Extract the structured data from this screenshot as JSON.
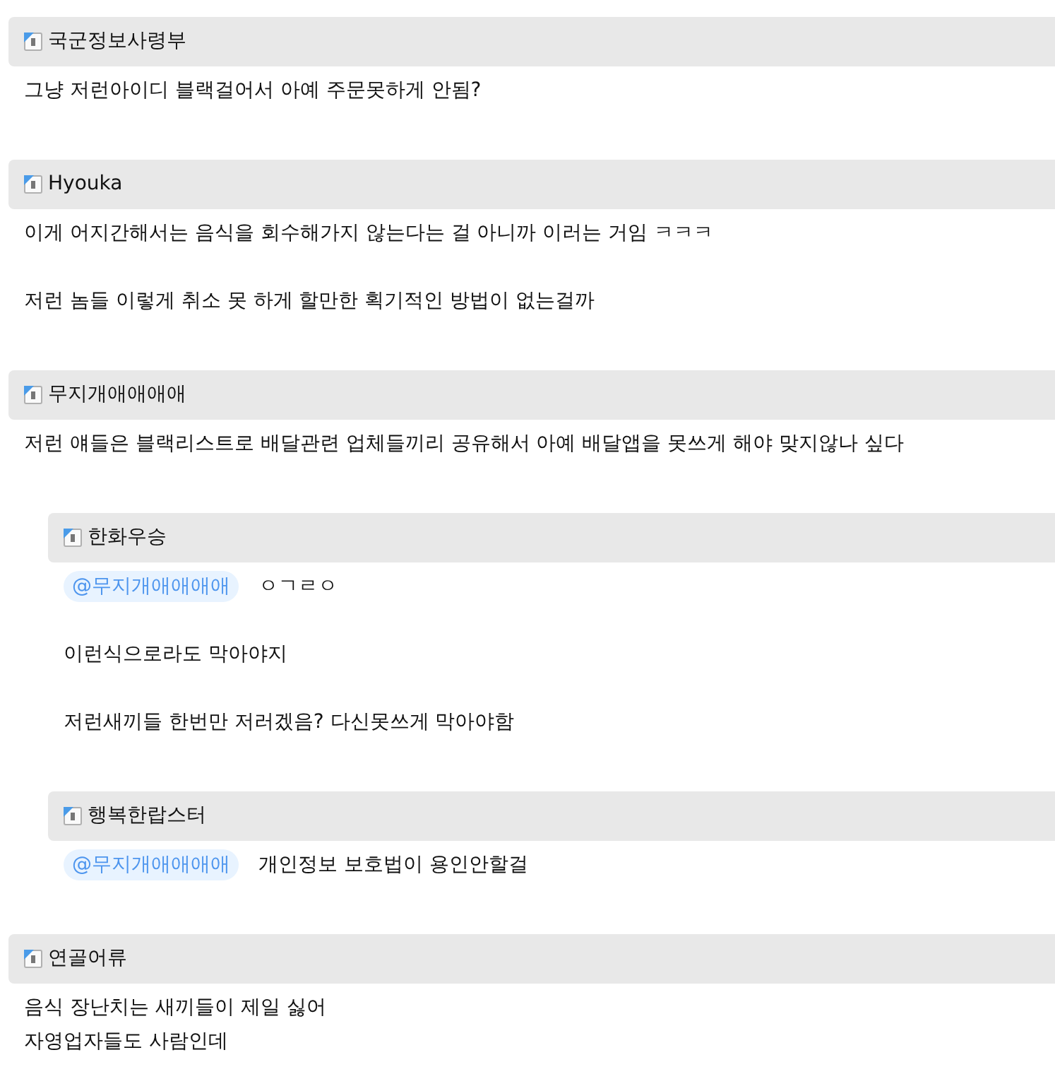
{
  "comments": [
    {
      "author": "국군정보사령부",
      "paragraphs": [
        {
          "lines": [
            "그냥 저런아이디 블랙걸어서 아예 주문못하게 안됨?"
          ]
        }
      ]
    },
    {
      "author": "Hyouka",
      "paragraphs": [
        {
          "lines": [
            "이게 어지간해서는 음식을 회수해가지 않는다는 걸 아니까 이러는 거임 ㅋㅋㅋ"
          ]
        },
        {
          "lines": [
            "저런 놈들 이렇게 취소 못 하게 할만한 획기적인 방법이 없는걸까"
          ]
        }
      ]
    },
    {
      "author": "무지개애애애애",
      "paragraphs": [
        {
          "lines": [
            "저런 얘들은 블랙리스트로 배달관련 업체들끼리 공유해서 아예 배달앱을 못쓰게 해야 맞지않나 싶다"
          ]
        }
      ],
      "replies": [
        {
          "author": "한화우승",
          "paragraphs": [
            {
              "mention": "@무지개애애애애",
              "lines": [
                "ㅇㄱㄹㅇ"
              ]
            },
            {
              "lines": [
                "이런식으로라도 막아야지"
              ]
            },
            {
              "lines": [
                "저런새끼들 한번만 저러겠음? 다신못쓰게 막아야함"
              ]
            }
          ]
        },
        {
          "author": "행복한랍스터",
          "paragraphs": [
            {
              "mention": "@무지개애애애애",
              "lines": [
                "개인정보 보호법이 용인안할걸"
              ]
            }
          ]
        }
      ]
    },
    {
      "author": "연골어류",
      "paragraphs": [
        {
          "lines": [
            "음식 장난치는 새끼들이 제일 싫어",
            "자영업자들도 사람인데"
          ]
        }
      ]
    }
  ]
}
